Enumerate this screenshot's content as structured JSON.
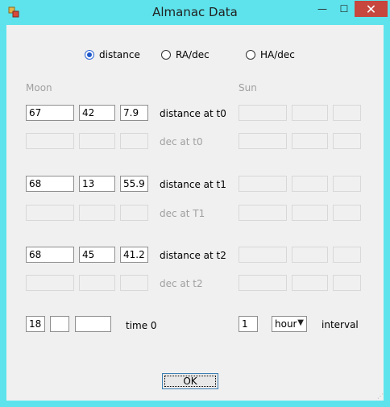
{
  "window": {
    "title": "Almanac Data",
    "minimize": "—",
    "maximize": "☐",
    "close": "✕"
  },
  "mode": {
    "options": [
      "distance",
      "RA/dec",
      "HA/dec"
    ],
    "selected": "distance"
  },
  "moon": {
    "header": "Moon",
    "rows": [
      {
        "label": "distance at t0",
        "values": [
          "67",
          "42",
          "7.9"
        ],
        "enabled": true
      },
      {
        "label": "dec at t0",
        "values": [
          "",
          "",
          ""
        ],
        "enabled": false
      },
      {
        "label": "distance at t1",
        "values": [
          "68",
          "13",
          "55.9"
        ],
        "enabled": true
      },
      {
        "label": "dec at T1",
        "values": [
          "",
          "",
          ""
        ],
        "enabled": false
      },
      {
        "label": "distance at t2",
        "values": [
          "68",
          "45",
          "41.2"
        ],
        "enabled": true
      },
      {
        "label": "dec at t2",
        "values": [
          "",
          "",
          ""
        ],
        "enabled": false
      }
    ]
  },
  "sun": {
    "header": "Sun"
  },
  "time": {
    "label": "time 0",
    "values": [
      "18",
      "",
      ""
    ]
  },
  "interval": {
    "label": "interval",
    "value": "1",
    "unit": "hour"
  },
  "ok_label": "OK",
  "colors": {
    "titlebar": "#5ee3ec",
    "close": "#c7463d",
    "client": "#f0f0f0",
    "radio_accent": "#1f58c9"
  }
}
